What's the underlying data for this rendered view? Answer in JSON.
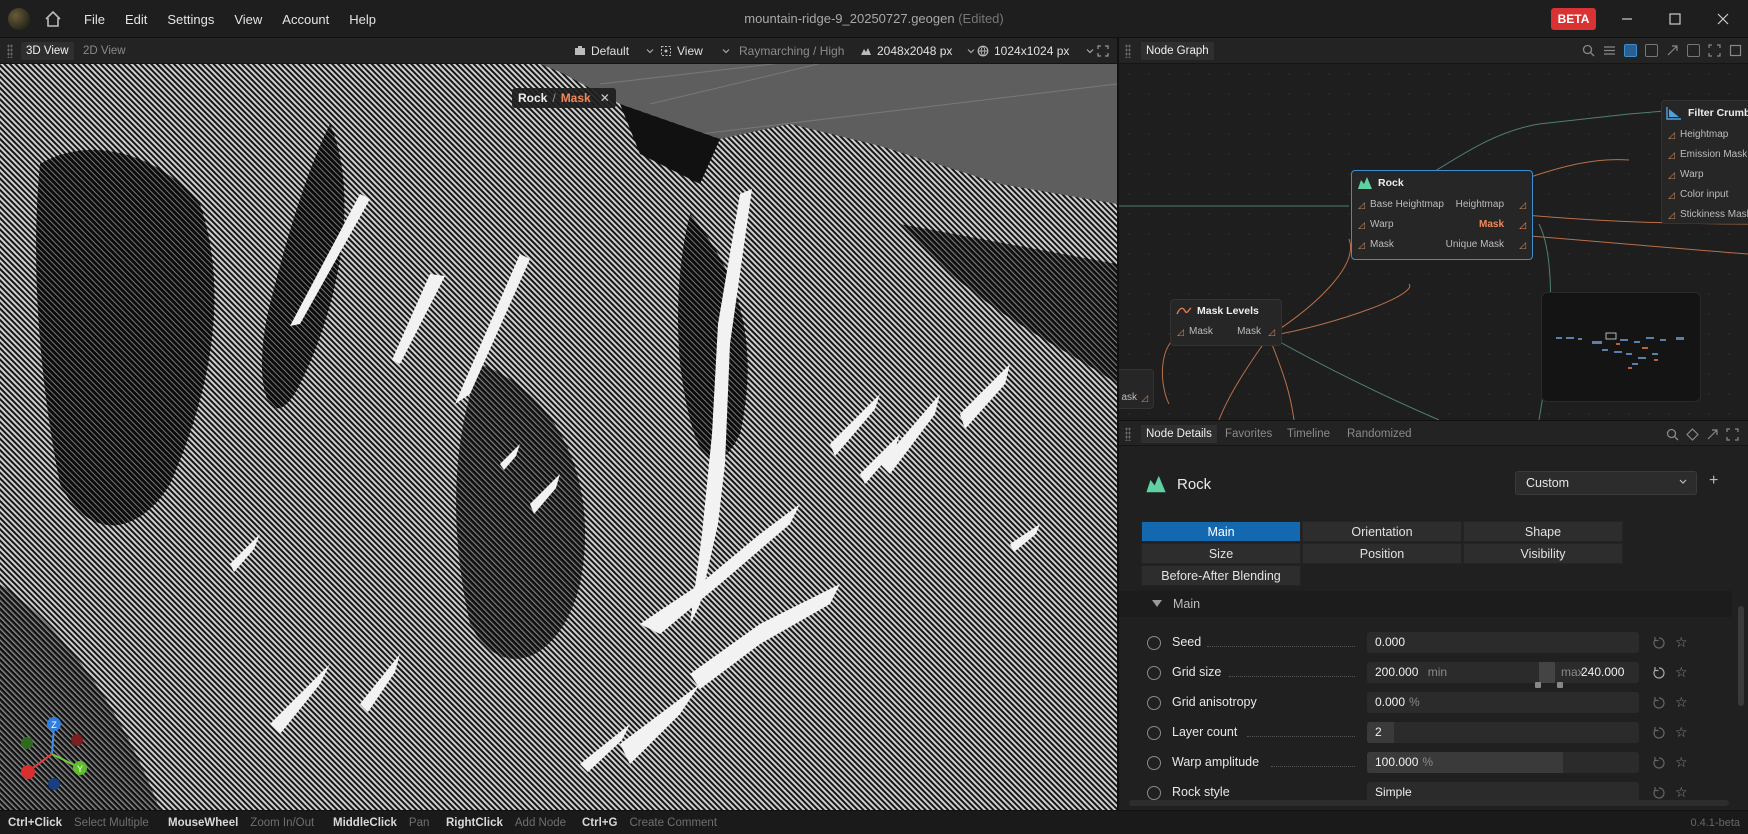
{
  "titlebar": {
    "menu": [
      "File",
      "Edit",
      "Settings",
      "View",
      "Account",
      "Help"
    ],
    "doc_title": "mountain-ridge-9_20250727.geogen",
    "edited": "(Edited)",
    "beta": "BETA"
  },
  "viewport_toolbar": {
    "tab_3d": "3D View",
    "tab_2d": "2D View",
    "camera_preset": "Default",
    "view_menu": "View",
    "render_mode": "Raymarching / High",
    "terrain_resolution": "2048x2048 px",
    "texture_resolution": "1024x1024 px"
  },
  "viewport": {
    "breadcrumb_node": "Rock",
    "breadcrumb_sep": "/",
    "breadcrumb_output": "Mask",
    "gizmo_z": "Z",
    "gizmo_y": "Y"
  },
  "node_graph": {
    "title": "Node Graph",
    "nodes": {
      "rock": {
        "title": "Rock",
        "inputs": [
          "Base Heightmap",
          "Warp",
          "Mask"
        ],
        "outputs": [
          "Heightmap",
          "Mask",
          "Unique Mask"
        ]
      },
      "mask_levels": {
        "title": "Mask Levels",
        "input": "Mask",
        "output": "Mask"
      },
      "filter_crumble": {
        "title": "Filter Crumble",
        "inputs": [
          "Heightmap",
          "Emission Mask",
          "Warp",
          "Color input",
          "Stickiness Mask"
        ]
      },
      "partial_node_label": "ask"
    }
  },
  "node_details": {
    "tabs": [
      "Node Details",
      "Favorites",
      "Timeline",
      "Randomized"
    ],
    "node_name": "Rock",
    "preset": "Custom",
    "param_tabs": [
      "Main",
      "Orientation",
      "Shape",
      "Size",
      "Position",
      "Visibility",
      "Before-After Blending"
    ],
    "section": "Main",
    "params": [
      {
        "label": "Seed",
        "value": "0.000",
        "unit": "",
        "fill": 0
      },
      {
        "label": "Grid size",
        "value": "200.000",
        "min_label": "min",
        "max_label": "max",
        "max_value": "240.000",
        "fill": 0
      },
      {
        "label": "Grid anisotropy",
        "value": "0.000",
        "unit": "%",
        "fill": 0
      },
      {
        "label": "Layer count",
        "value": "2",
        "unit": "",
        "fill": 0.1
      },
      {
        "label": "Warp amplitude",
        "value": "100.000",
        "unit": "%",
        "fill": 0.72
      },
      {
        "label": "Rock style",
        "value": "Simple",
        "unit": "",
        "fill": 0
      }
    ]
  },
  "statusbar": {
    "shortcuts": [
      {
        "key": "Ctrl+Click",
        "desc": "Select Multiple"
      },
      {
        "key": "MouseWheel",
        "desc": "Zoom In/Out"
      },
      {
        "key": "MiddleClick",
        "desc": "Pan"
      },
      {
        "key": "RightClick",
        "desc": "Add Node"
      },
      {
        "key": "Ctrl+G",
        "desc": "Create Comment"
      }
    ],
    "version": "0.4.1-beta"
  },
  "colors": {
    "accent": "#1468b0",
    "beta": "#d83232",
    "mask_output": "#f08a5a",
    "node_selected": "#3d8ed0"
  }
}
